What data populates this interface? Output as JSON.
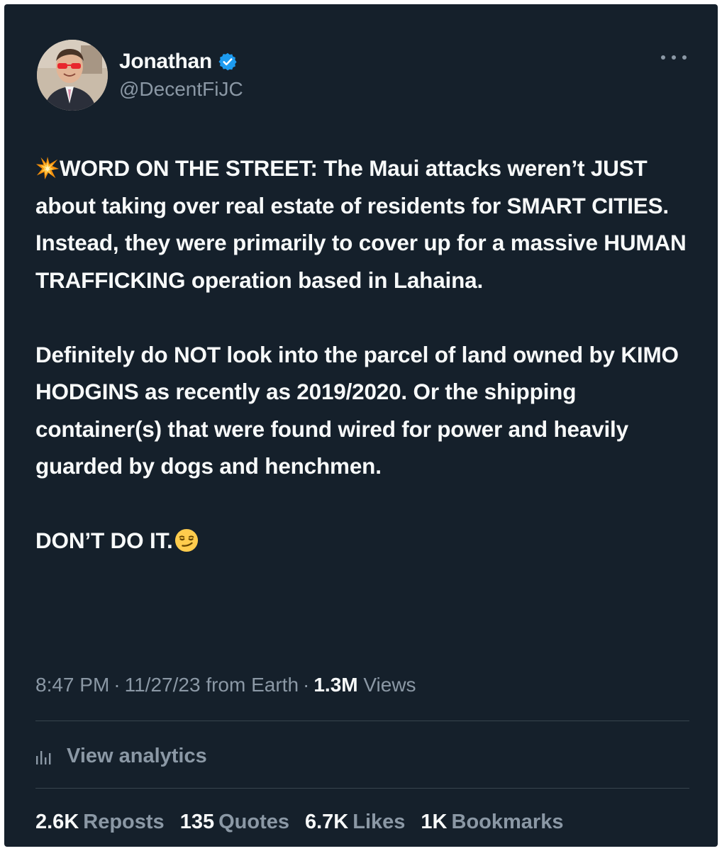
{
  "tweet": {
    "author": {
      "display_name": "Jonathan",
      "handle": "@DecentFiJC",
      "verified": true,
      "verified_color": "#1d9bf0"
    },
    "more_icon": "more-horizontal-icon",
    "paragraphs": [
      {
        "leading_icon": "collision-emoji-icon",
        "text": "WORD ON THE STREET: The Maui attacks weren’t JUST about taking over real estate of residents for SMART CITIES. Instead, they were primarily to cover up for a massive HUMAN TRAFFICKING operation based in Lahaina."
      },
      {
        "text": "Definitely do NOT look into the parcel of land owned by KIMO HODGINS as recently as 2019/2020. Or the shipping container(s) that were found wired for power and heavily guarded by dogs and henchmen."
      },
      {
        "text": "DON’T DO IT.",
        "trailing_icon": "smirking-face-emoji-icon"
      }
    ],
    "meta": {
      "time": "8:47 PM",
      "separator": "·",
      "date": "11/27/23",
      "source": "from Earth",
      "views_count": "1.3M",
      "views_label": "Views"
    },
    "analytics": {
      "icon": "analytics-bar-chart-icon",
      "label": "View analytics"
    },
    "stats": [
      {
        "count": "2.6K",
        "label": "Reposts"
      },
      {
        "count": "135",
        "label": "Quotes"
      },
      {
        "count": "6.7K",
        "label": "Likes"
      },
      {
        "count": "1K",
        "label": "Bookmarks"
      }
    ]
  },
  "colors": {
    "background": "#15202b",
    "primary_text": "#f7f9f9",
    "secondary_text": "#8b98a5",
    "divider": "#38444d",
    "verified": "#1d9bf0"
  }
}
